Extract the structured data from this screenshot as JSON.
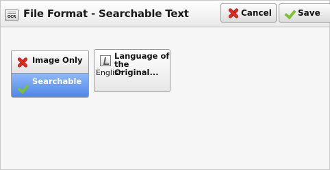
{
  "window": {
    "title": "File Format - Searchable Text",
    "icon_text": "OCR"
  },
  "toolbar": {
    "cancel_label": "Cancel",
    "save_label": "Save"
  },
  "options": {
    "items": [
      {
        "label": "Image Only",
        "selected": false,
        "icon": "red-x-icon"
      },
      {
        "label": "Searchable",
        "selected": true,
        "icon": "green-check-icon"
      }
    ]
  },
  "language": {
    "title_line1": "Language of",
    "title_line2": "the Original...",
    "value": "English"
  },
  "colors": {
    "selection": "#4f86ea",
    "cancel_icon": "#e02a1f",
    "check_icon": "#7cc230"
  }
}
